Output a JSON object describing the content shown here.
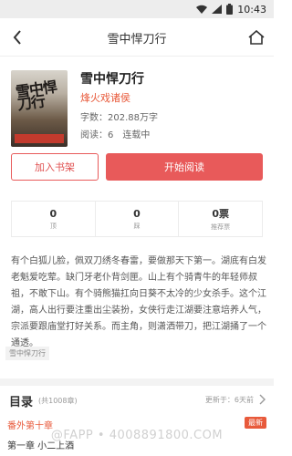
{
  "statusbar": {
    "time": "10:43"
  },
  "nav": {
    "title": "雪中悍刀行"
  },
  "book": {
    "title": "雪中悍刀行",
    "author": "烽火戏诸侯",
    "wordcount": "字数：202.88万字",
    "read_label": "阅读：6",
    "status": "连载中",
    "cover_text": "雪中悍刀行"
  },
  "actions": {
    "add_shelf": "加入书架",
    "start_read": "开始阅读"
  },
  "stats": [
    {
      "value": "0",
      "label": "顶"
    },
    {
      "value": "0",
      "label": "踩"
    },
    {
      "value": "0票",
      "label": "推荐票"
    }
  ],
  "synopsis": "有个白狐儿脸，佩双刀绣冬春雷，要做那天下第一。湖底有白发老魁爱吃荤。缺门牙老仆背剑匣。山上有个骑青牛的年轻师叔祖，不敢下山。有个骑熊猫扛向日葵不太冷的少女杀手。这个江湖，高人出行要注重出尘装扮，女侠行走江湖要注意培养人气，宗派要跟庙堂打好关系。而主角，则潇洒带刀，把江湖捅了一个通透。",
  "tag": "雪中悍刀行",
  "toc": {
    "title": "目录",
    "count": "(共1008章)",
    "updated": "更新于：6天前",
    "chapters": [
      {
        "title": "番外第十章",
        "badge": "最新"
      },
      {
        "title": "第一章 小二上酒"
      }
    ]
  },
  "watermark": "@FAPP • 4008891800.COM",
  "colors": {
    "accent": "#e85a5a",
    "author": "#e85a3b"
  }
}
